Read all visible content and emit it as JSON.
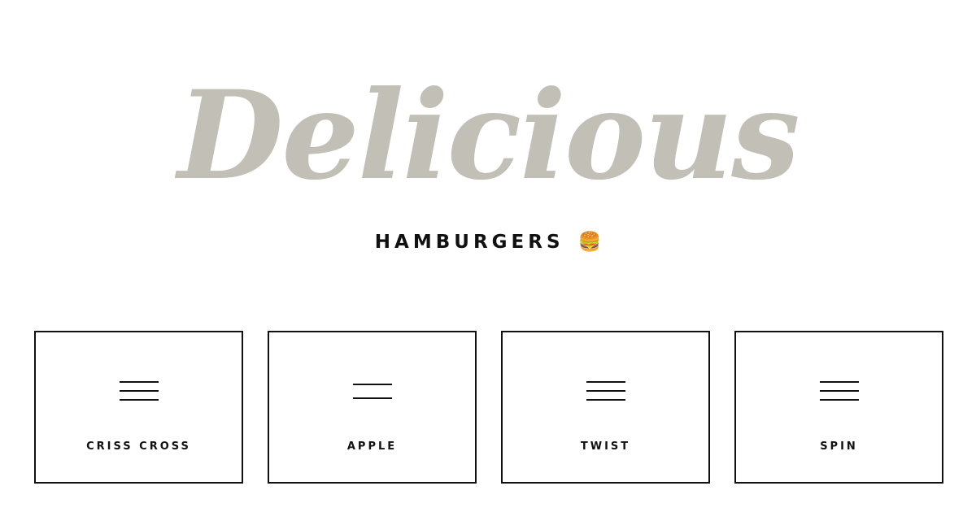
{
  "header": {
    "title": "Delicious",
    "subtitle": "HAMBURGERS",
    "subtitle_emoji": "🍔"
  },
  "cards": [
    {
      "label": "CRISS CROSS",
      "icon": "hamburger-three-lines-icon"
    },
    {
      "label": "APPLE",
      "icon": "hamburger-two-lines-icon"
    },
    {
      "label": "TWIST",
      "icon": "hamburger-three-lines-icon"
    },
    {
      "label": "SPIN",
      "icon": "hamburger-three-lines-icon"
    }
  ],
  "colors": {
    "title": "#c2c0b6",
    "text": "#111111",
    "background": "#ffffff"
  }
}
